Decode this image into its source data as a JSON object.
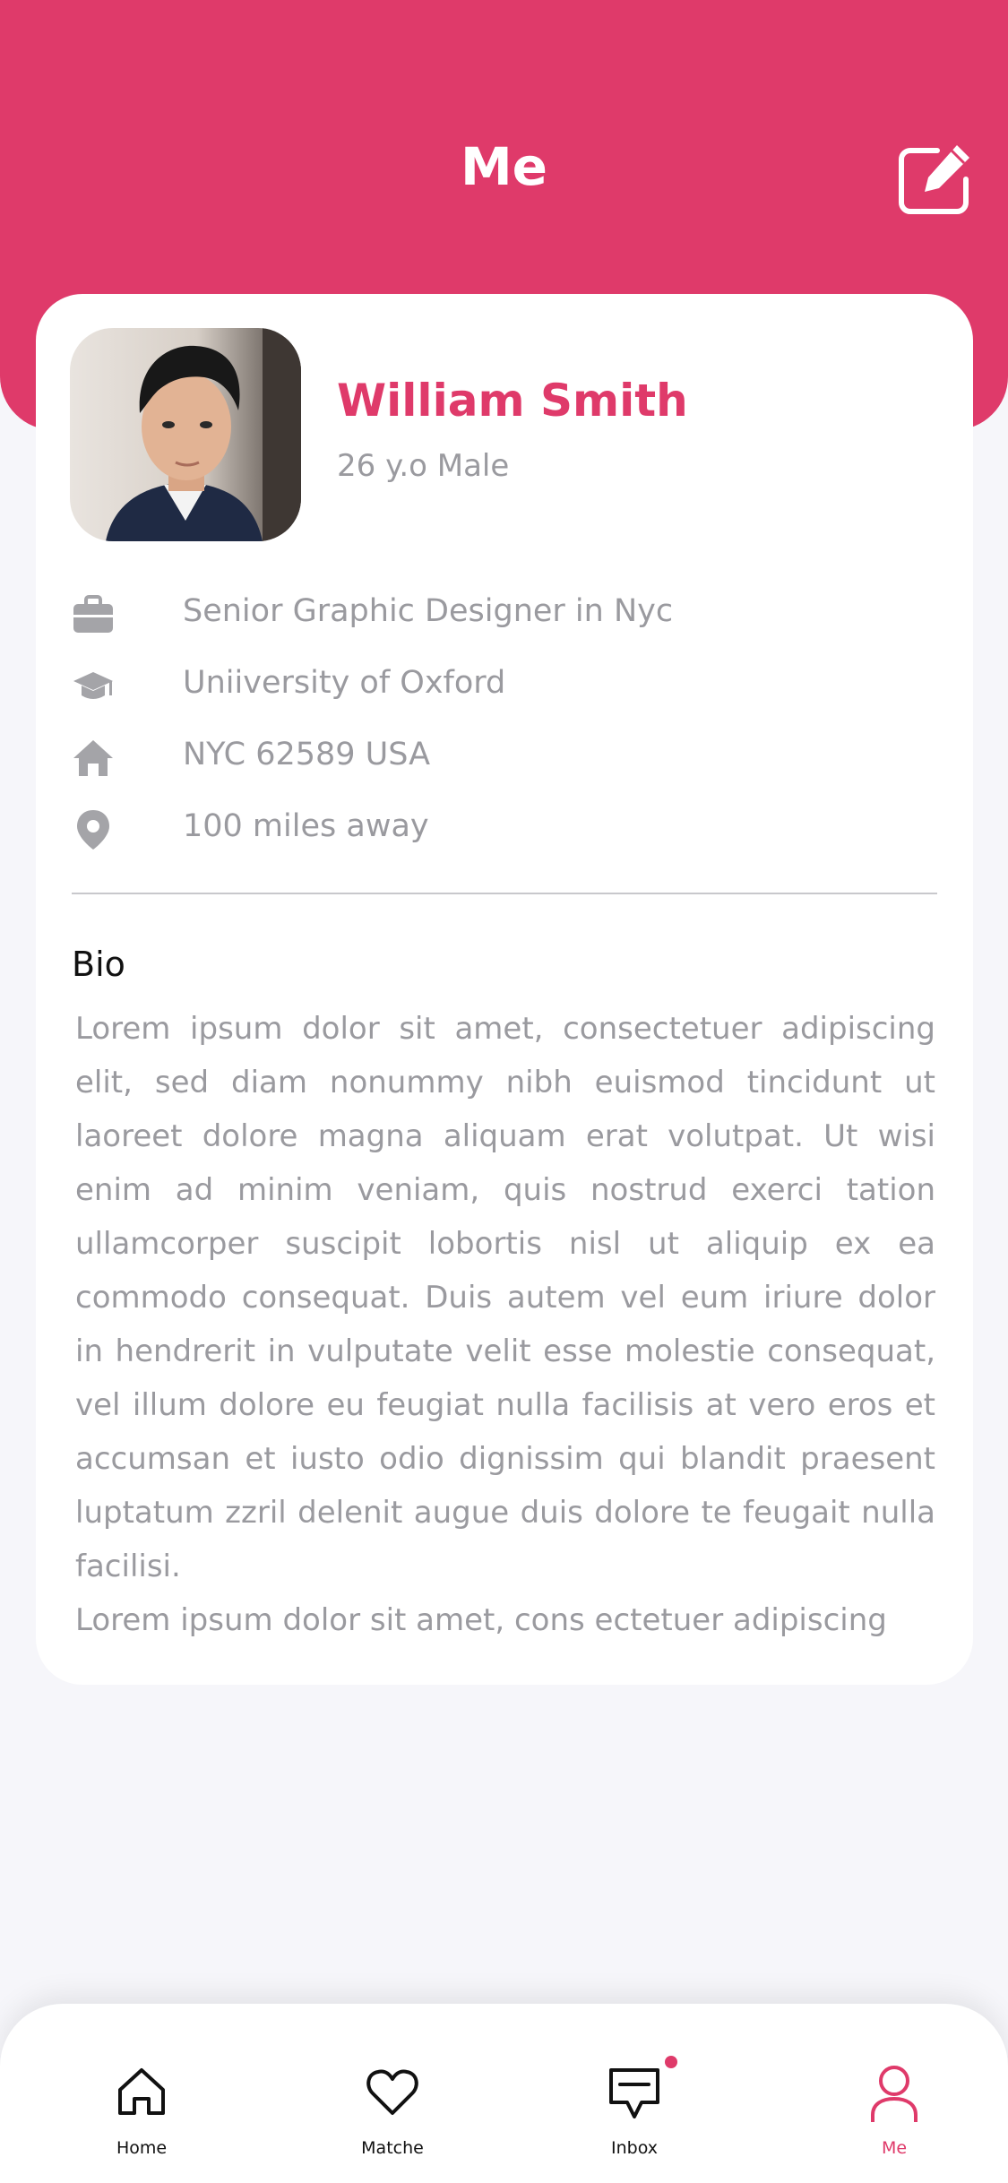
{
  "header": {
    "title": "Me",
    "edit_icon": "edit-icon"
  },
  "colors": {
    "accent": "#df3a6a",
    "muted_text": "#9a9a9f",
    "background": "#f6f6fa"
  },
  "profile": {
    "name": "William Smith",
    "subline": "26 y.o Male",
    "avatar_alt": "profile-photo"
  },
  "info": [
    {
      "icon": "briefcase-icon",
      "text": "Senior Graphic Designer in Nyc"
    },
    {
      "icon": "graduation-cap-icon",
      "text": "Uniiversity of Oxford"
    },
    {
      "icon": "home-icon",
      "text": "NYC 62589 USA"
    },
    {
      "icon": "location-pin-icon",
      "text": "100 miles away"
    }
  ],
  "bio": {
    "title": "Bio",
    "paragraphs": [
      "Lorem ipsum dolor sit amet, consectetuer adipiscing elit, sed diam nonummy nibh euismod tincidunt ut laoreet dolore magna aliquam erat volutpat. Ut wisi enim ad minim veniam, quis nostrud exerci tation ullamcorper suscipit lobortis nisl ut aliquip ex ea commodo consequat. Duis autem vel eum iriure dolor in hendrerit in vulputate velit esse molestie consequat, vel illum dolore eu feugiat nulla facilisis at vero eros et accumsan et iusto odio dignissim qui blandit praesent luptatum zzril delenit augue duis dolore te feugait nulla facilisi.",
      "Lorem ipsum dolor sit amet, cons ectetuer adipiscing"
    ]
  },
  "tabbar": {
    "items": [
      {
        "label": "Home",
        "icon": "home-icon",
        "active": false
      },
      {
        "label": "Matche",
        "icon": "heart-icon",
        "active": false
      },
      {
        "label": "Inbox",
        "icon": "message-icon",
        "active": false,
        "badge": true
      },
      {
        "label": "Me",
        "icon": "user-icon",
        "active": true
      }
    ]
  }
}
